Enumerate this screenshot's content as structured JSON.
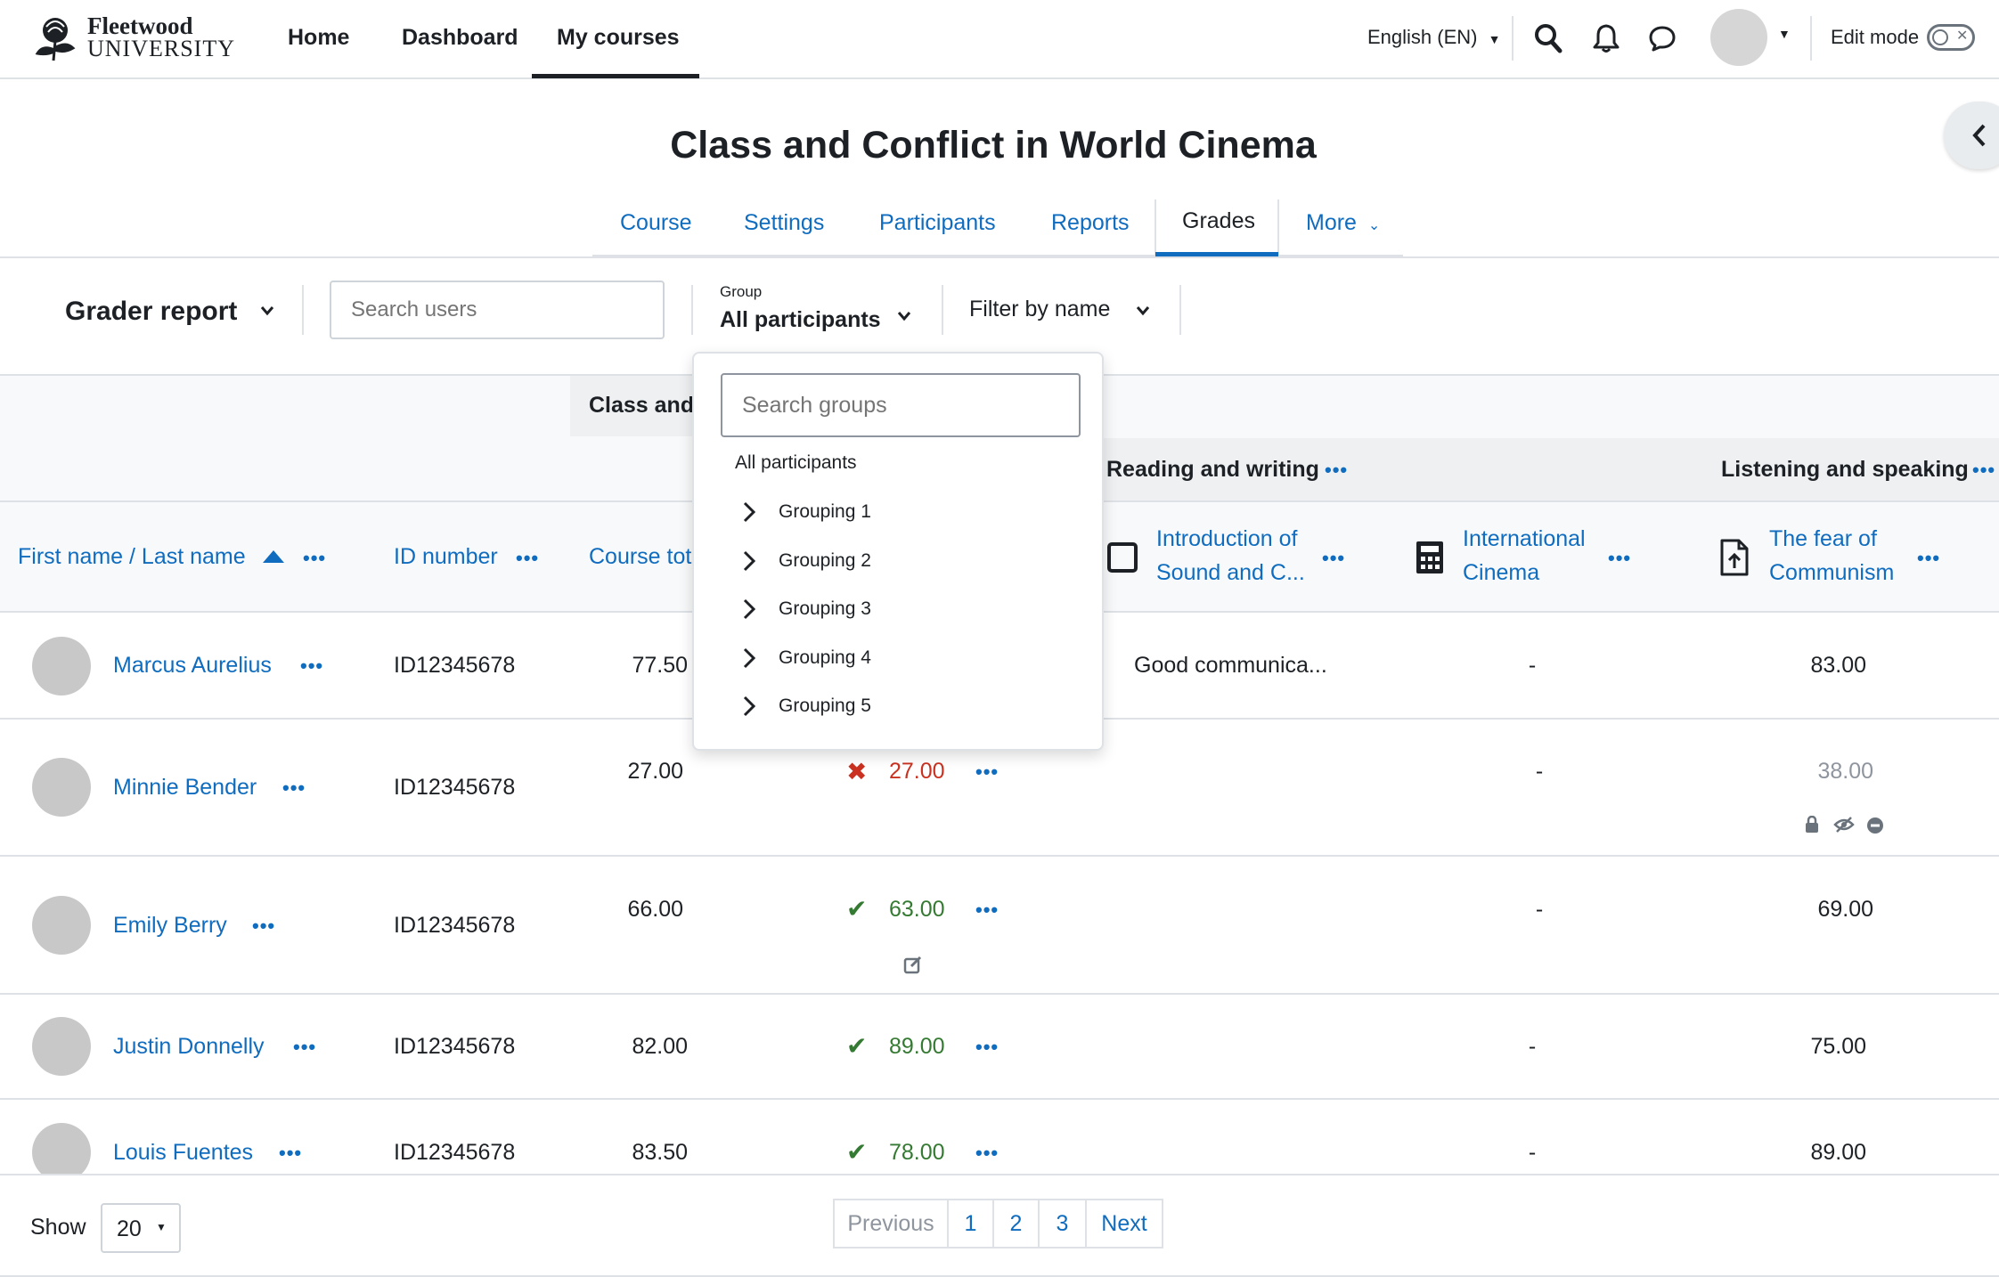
{
  "brand": {
    "name_line1": "Fleetwood",
    "name_line2": "UNIVERSITY"
  },
  "nav": {
    "home": "Home",
    "dashboard": "Dashboard",
    "my_courses": "My courses"
  },
  "language": "English (EN)",
  "edit_mode_label": "Edit mode",
  "course_title": "Class and Conflict in World Cinema",
  "tabs": [
    "Course",
    "Settings",
    "Participants",
    "Reports",
    "Grades",
    "More"
  ],
  "toolbar": {
    "report": "Grader report",
    "search_placeholder": "Search users",
    "group_label": "Group",
    "group_value": "All participants",
    "filter_label": "Filter by name"
  },
  "dropdown": {
    "search_placeholder": "Search groups",
    "all": "All participants",
    "groupings": [
      "Grouping 1",
      "Grouping 2",
      "Grouping 3",
      "Grouping 4",
      "Grouping 5"
    ]
  },
  "categories": {
    "class": "Class and",
    "reading": "Reading and writing",
    "listening": "Listening and speaking"
  },
  "columns": {
    "name": "First name / Last name",
    "id": "ID number",
    "total": "Course tot",
    "item1_line1": "Introduction of",
    "item1_line2": "Sound and C...",
    "item2_line1": "International",
    "item2_line2": "Cinema",
    "item3_line1": "The fear of",
    "item3_line2": "Communism"
  },
  "rows": [
    {
      "name": "Marcus Aurelius",
      "id": "ID12345678",
      "total": "77.50",
      "grade": "",
      "feedback": "Good communica...",
      "intl": "-",
      "fear": "83.00"
    },
    {
      "name": "Minnie Bender",
      "id": "ID12345678",
      "total": "27.00",
      "grade": "27.00",
      "feedback": "",
      "intl": "-",
      "fear": "38.00"
    },
    {
      "name": "Emily Berry",
      "id": "ID12345678",
      "total": "66.00",
      "grade": "63.00",
      "feedback": "",
      "intl": "-",
      "fear": "69.00"
    },
    {
      "name": "Justin Donnelly",
      "id": "ID12345678",
      "total": "82.00",
      "grade": "89.00",
      "feedback": "",
      "intl": "-",
      "fear": "75.00"
    },
    {
      "name": "Louis Fuentes",
      "id": "ID12345678",
      "total": "83.50",
      "grade": "78.00",
      "feedback": "",
      "intl": "-",
      "fear": "89.00"
    }
  ],
  "footer": {
    "show_label": "Show",
    "per_page": "20",
    "previous": "Previous",
    "pages": [
      "1",
      "2",
      "3"
    ],
    "next": "Next"
  },
  "colors": {
    "link": "#0f6cbf",
    "fail": "#ca3120",
    "pass": "#357a32",
    "muted": "#8f959e"
  }
}
